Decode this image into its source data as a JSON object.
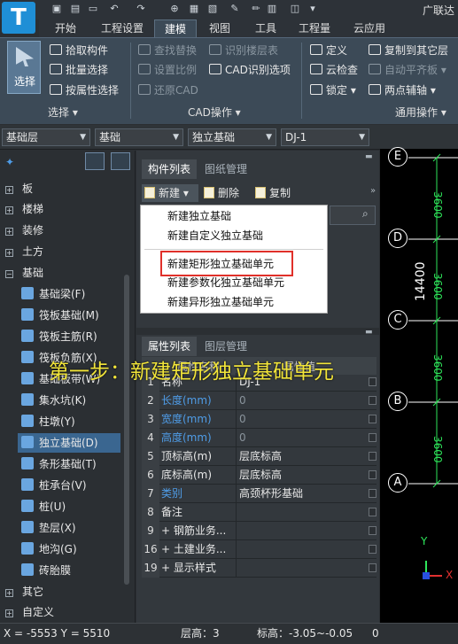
{
  "app": {
    "title": "广联达",
    "logo": "T"
  },
  "tabs": [
    "开始",
    "工程设置",
    "建模",
    "视图",
    "工具",
    "工程量",
    "云应用"
  ],
  "ribbon": {
    "select_label": "选择",
    "col1": [
      "拾取构件",
      "批量选择",
      "按属性选择"
    ],
    "col2": [
      "查找替换",
      "设置比例",
      "还原CAD"
    ],
    "col3": [
      "识别楼层表",
      "CAD识别选项"
    ],
    "col4": [
      "定义",
      "云检查",
      "锁定"
    ],
    "col5": [
      "复制到其它层",
      "自动平齐板",
      "两点辅轴"
    ],
    "groups": [
      "选择",
      "CAD操作",
      "通用操作"
    ]
  },
  "dropdowns": [
    "基础层",
    "基础",
    "独立基础",
    "DJ-1"
  ],
  "tree": {
    "top": [
      "板",
      "楼梯",
      "装修",
      "土方",
      "基础"
    ],
    "children": [
      "基础梁(F)",
      "筏板基础(M)",
      "筏板主筋(R)",
      "筏板负筋(X)",
      "基础板带(W)",
      "集水坑(K)",
      "柱墩(Y)",
      "独立基础(D)",
      "条形基础(T)",
      "桩承台(V)",
      "桩(U)",
      "垫层(X)",
      "地沟(G)",
      "砖胎膜"
    ],
    "bottom": [
      "其它",
      "自定义"
    ],
    "selected": "独立基础(D)"
  },
  "component_panel": {
    "tabs": [
      "构件列表",
      "图纸管理"
    ],
    "toolbar": [
      "新建",
      "删除",
      "复制"
    ],
    "menu": [
      "新建独立基础",
      "新建自定义独立基础",
      "新建矩形独立基础单元",
      "新建参数化独立基础单元",
      "新建异形独立基础单元"
    ]
  },
  "property_panel": {
    "tabs": [
      "属性列表",
      "图层管理"
    ],
    "headers": [
      "属性名称",
      "属性值"
    ],
    "rows": [
      {
        "n": "1",
        "k": "名称",
        "v": "DJ-1",
        "blue": false
      },
      {
        "n": "2",
        "k": "长度(mm)",
        "v": "0",
        "blue": true
      },
      {
        "n": "3",
        "k": "宽度(mm)",
        "v": "0",
        "blue": true
      },
      {
        "n": "4",
        "k": "高度(mm)",
        "v": "0",
        "blue": true
      },
      {
        "n": "5",
        "k": "顶标高(m)",
        "v": "层底标高",
        "blue": false
      },
      {
        "n": "6",
        "k": "底标高(m)",
        "v": "层底标高",
        "blue": false
      },
      {
        "n": "7",
        "k": "类别",
        "v": "高颈杯形基础",
        "blue": true
      },
      {
        "n": "8",
        "k": "备注",
        "v": "",
        "blue": false
      },
      {
        "n": "9",
        "k": "+ 钢筋业务...",
        "v": "",
        "blue": false
      },
      {
        "n": "16",
        "k": "+ 土建业务...",
        "v": "",
        "blue": false
      },
      {
        "n": "19",
        "k": "+ 显示样式",
        "v": "",
        "blue": false
      }
    ]
  },
  "canvas": {
    "axes": [
      "E",
      "D",
      "C",
      "B",
      "A"
    ],
    "dimension": "14400",
    "side_dims": [
      "3600",
      "3600",
      "3600",
      "3600"
    ],
    "ucs": [
      "Y",
      "X"
    ]
  },
  "annotation": "第一步：新建矩形独立基础单元",
  "status": {
    "coords": "X = -5553 Y = 5510",
    "floor": "层高：3",
    "elev": "标高：-3.05~-0.05",
    "extra": "0"
  },
  "colors": {
    "blue_label": "#4f9de8",
    "highlight": "#e0302a",
    "annotation": "#f2e53a"
  }
}
